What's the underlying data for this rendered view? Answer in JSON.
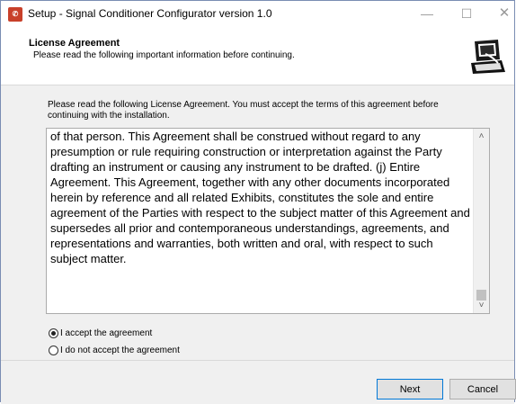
{
  "window": {
    "title": "Setup - Signal Conditioner Configurator version 1.0",
    "app_icon": "setup-app-icon",
    "controls": {
      "minimize": "—",
      "maximize": "☐",
      "close": "✕"
    }
  },
  "header": {
    "title": "License Agreement",
    "subtitle": "Please read the following important information before continuing.",
    "icon": "installer-computer-icon"
  },
  "body": {
    "intro": "Please read the following License Agreement. You must accept the terms of this agreement before continuing with the installation.",
    "license_text": "of that person. This Agreement shall be construed without regard to any presumption or rule requiring construction or interpretation against the Party drafting an instrument or causing any instrument to be drafted. (j) Entire Agreement. This Agreement, together with any other documents incorporated herein by reference and all related Exhibits, constitutes the sole and entire agreement of the Parties with respect to the subject matter of this Agreement and supersedes all prior and contemporaneous understandings, agreements, and representations and warranties, both written and oral, with respect to such subject matter.",
    "radios": [
      {
        "label": "I accept the agreement",
        "checked": true
      },
      {
        "label": "I do not accept the agreement",
        "checked": false
      }
    ]
  },
  "footer": {
    "next_label": "Next",
    "cancel_label": "Cancel"
  }
}
